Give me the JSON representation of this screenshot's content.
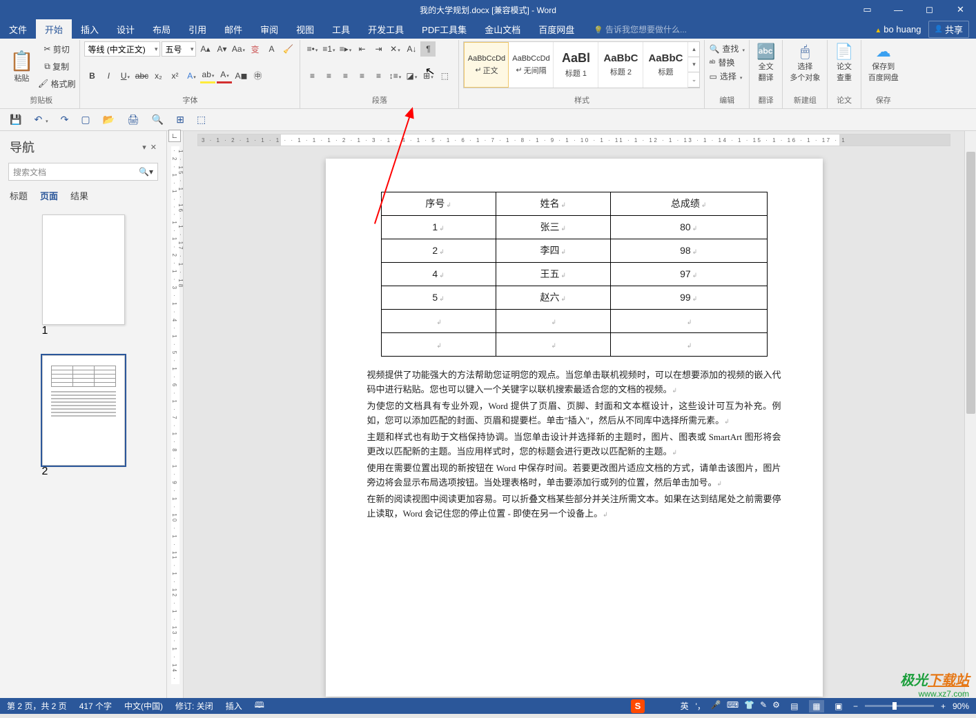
{
  "titlebar": {
    "title": "我的大学规划.docx [兼容模式] - Word"
  },
  "menubar": {
    "tabs": [
      "文件",
      "开始",
      "插入",
      "设计",
      "布局",
      "引用",
      "邮件",
      "审阅",
      "视图",
      "工具",
      "开发工具",
      "PDF工具集",
      "金山文档",
      "百度网盘"
    ],
    "active": 1,
    "tell": "告诉我您想要做什么...",
    "user": "bo huang",
    "share": "共享"
  },
  "ribbon": {
    "clipboard": {
      "paste": "粘贴",
      "cut": "剪切",
      "copy": "复制",
      "painter": "格式刷",
      "label": "剪贴板"
    },
    "font": {
      "family": "等线 (中文正文)",
      "size": "五号",
      "label": "字体"
    },
    "paragraph": {
      "label": "段落"
    },
    "styles": {
      "items": [
        {
          "preview": "AaBbCcDd",
          "name": "正文",
          "marker": "↵"
        },
        {
          "preview": "AaBbCcDd",
          "name": "无间隔",
          "marker": "↵"
        },
        {
          "preview": "AaBl",
          "name": "标题 1",
          "big": true
        },
        {
          "preview": "AaBbC",
          "name": "标题 2",
          "big": true
        },
        {
          "preview": "AaBbC",
          "name": "标题",
          "big": true
        }
      ],
      "label": "样式"
    },
    "editing": {
      "find": "查找",
      "replace": "替换",
      "select": "选择",
      "label": "编辑"
    },
    "translate": {
      "line1": "全文",
      "line2": "翻译",
      "label": "翻译"
    },
    "selectgroup": {
      "line1": "选择",
      "line2": "多个对象",
      "label": "新建组"
    },
    "paper": {
      "line1": "论文",
      "line2": "查重",
      "label": "论文"
    },
    "save": {
      "line1": "保存到",
      "line2": "百度网盘",
      "label": "保存"
    }
  },
  "nav": {
    "title": "导航",
    "placeholder": "搜索文档",
    "tabs": [
      "标题",
      "页面",
      "结果"
    ],
    "active": 1,
    "page1": "1",
    "page2": "2"
  },
  "ruler_h": "3 · 1 · 2 · 1 · 1 · 1 ·  · 1 · 1 · 1 · 2 · 1 · 3 · 1 · 4 · 1 · 5 · 1 · 6 · 1 · 7 · 1 · 8 · 1 · 9 · 1 · 10 · 1 · 11 · 1 · 12 · 1 · 13 · 1 · 14 · 1 · 15 · 1 · 16 · 1 · 17 · 1",
  "ruler_v": "· 2 · 1 · 1 · · · 1 · 1 · 2 · 1 · 3 · 1 · 4 · 1 · 5 · 1 · 6 · 1 · 7 · 1 · 8 · 1 · 9 · 1 · 10 · 1 · 11 · 1 · 12 · 1 · 13 · 1 · 14 · 1 · 15 · 1 · 16 · 1 · 17 · 1 · 18",
  "table": {
    "header": [
      "序号",
      "姓名",
      "总成绩"
    ],
    "rows": [
      [
        "1",
        "张三",
        "80"
      ],
      [
        "2",
        "李四",
        "98"
      ],
      [
        "4",
        "王五",
        "97"
      ],
      [
        "5",
        "赵六",
        "99"
      ],
      [
        "",
        "",
        ""
      ],
      [
        "",
        "",
        ""
      ]
    ]
  },
  "paragraphs": [
    "视频提供了功能强大的方法帮助您证明您的观点。当您单击联机视频时，可以在想要添加的视频的嵌入代码中进行粘贴。您也可以键入一个关键字以联机搜索最适合您的文档的视频。",
    "为使您的文档具有专业外观，Word 提供了页眉、页脚、封面和文本框设计，这些设计可互为补充。例如，您可以添加匹配的封面、页眉和提要栏。单击\"插入\"，然后从不同库中选择所需元素。",
    "主题和样式也有助于文档保持协调。当您单击设计并选择新的主题时，图片、图表或 SmartArt 图形将会更改以匹配新的主题。当应用样式时，您的标题会进行更改以匹配新的主题。",
    "使用在需要位置出现的新按钮在 Word 中保存时间。若要更改图片适应文档的方式，请单击该图片，图片旁边将会显示布局选项按钮。当处理表格时，单击要添加行或列的位置，然后单击加号。",
    "在新的阅读视图中阅读更加容易。可以折叠文档某些部分并关注所需文本。如果在达到结尾处之前需要停止读取，Word 会记住您的停止位置 - 即使在另一个设备上。"
  ],
  "status": {
    "page": "第 2 页，共 2 页",
    "words": "417 个字",
    "lang": "中文(中国)",
    "track": "修订: 关闭",
    "insert": "插入",
    "ime": "英",
    "zoom": "90%"
  },
  "watermark": {
    "brand_g": "极光",
    "brand_x": "下载站",
    "url": "www.xz7.com"
  }
}
